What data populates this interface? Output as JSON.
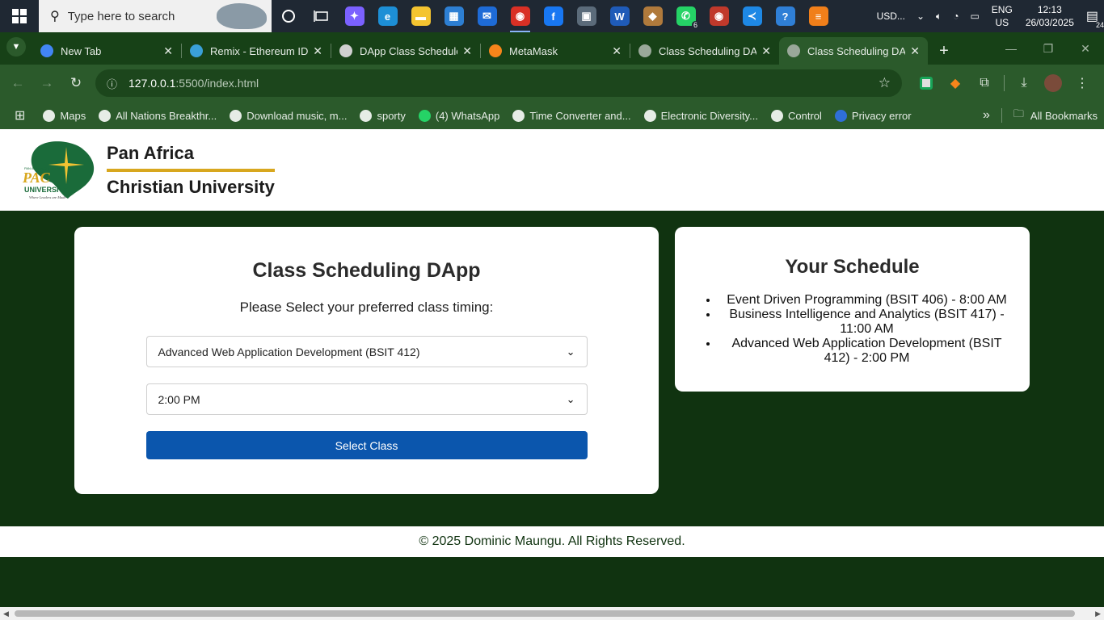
{
  "taskbar": {
    "search_placeholder": "Type here to search",
    "pinned": [
      {
        "name": "copilot-icon",
        "glyph": "✦",
        "color": "#7b61ff"
      },
      {
        "name": "edge-icon",
        "glyph": "e",
        "color": "#1d8fd6"
      },
      {
        "name": "file-explorer-icon",
        "glyph": "▬",
        "color": "#f4c430"
      },
      {
        "name": "microsoft-store-icon",
        "glyph": "▦",
        "color": "#2d7fd3"
      },
      {
        "name": "mail-icon",
        "glyph": "✉",
        "color": "#1e6bd6"
      },
      {
        "name": "chrome-icon",
        "glyph": "◉",
        "color": "#d93025"
      },
      {
        "name": "facebook-icon",
        "glyph": "f",
        "color": "#1877f2"
      },
      {
        "name": "photos-icon",
        "glyph": "▣",
        "color": "#5b6b7a"
      },
      {
        "name": "word-icon",
        "glyph": "W",
        "color": "#1f5bb8"
      },
      {
        "name": "package-icon",
        "glyph": "◆",
        "color": "#b07a3c"
      },
      {
        "name": "whatsapp-icon",
        "glyph": "✆",
        "color": "#25d366"
      },
      {
        "name": "chrome-profile-icon",
        "glyph": "◉",
        "color": "#c0392b"
      },
      {
        "name": "vscode-icon",
        "glyph": "≺",
        "color": "#1e88e5"
      },
      {
        "name": "help-icon",
        "glyph": "?",
        "color": "#2f7fd6"
      },
      {
        "name": "stack-icon",
        "glyph": "≡",
        "color": "#f07f1a"
      }
    ],
    "whatsapp_badge": "6",
    "currency": "USD...",
    "lang_top": "ENG",
    "lang_bottom": "US",
    "time": "12:13",
    "date": "26/03/2025",
    "notif_count": "24"
  },
  "tabs": [
    {
      "title": "New Tab",
      "fav": "#4285f4",
      "favicon": "chrome-icon"
    },
    {
      "title": "Remix - Ethereum IDE",
      "fav": "#3aa0d8",
      "favicon": "remix-icon"
    },
    {
      "title": "DApp Class Schedule",
      "fav": "#d0d0d0",
      "favicon": "openai-icon"
    },
    {
      "title": "MetaMask",
      "fav": "#f6851b",
      "favicon": "metamask-icon"
    },
    {
      "title": "Class Scheduling DAp",
      "fav": "#9aa89a",
      "favicon": "globe-icon"
    },
    {
      "title": "Class Scheduling DA",
      "fav": "#9aa89a",
      "favicon": "globe-icon"
    }
  ],
  "toolbar": {
    "url_host": "127.0.0.1",
    "url_path": ":5500/index.html"
  },
  "bookmarks": [
    {
      "label": "Maps",
      "color": "#e6ece6"
    },
    {
      "label": "All Nations Breakthr...",
      "color": "#e6ece6"
    },
    {
      "label": "Download music, m...",
      "color": "#e6ece6"
    },
    {
      "label": "sporty",
      "color": "#e6ece6"
    },
    {
      "label": "(4) WhatsApp",
      "color": "#25d366"
    },
    {
      "label": "Time Converter and...",
      "color": "#e6ece6"
    },
    {
      "label": "Electronic Diversity...",
      "color": "#e6ece6"
    },
    {
      "label": "Control",
      "color": "#e6ece6"
    },
    {
      "label": "Privacy error",
      "color": "#2f6fd8"
    }
  ],
  "all_bookmarks": "All Bookmarks",
  "logo": {
    "line1": "Pan Africa",
    "line2": "Christian University",
    "mark_top": "PAN AFRICA CHRISTIAN",
    "mark_pac": "PAC",
    "mark_univ": "UNIVERSITY",
    "mark_tagline": "Where Leaders are Made"
  },
  "main": {
    "title": "Class Scheduling DApp",
    "prompt": "Please Select your preferred class timing:",
    "class_selected": "Advanced Web Application Development (BSIT 412)",
    "time_selected": "2:00 PM",
    "button": "Select Class"
  },
  "schedule": {
    "title": "Your Schedule",
    "items": [
      "Event Driven Programming (BSIT 406) - 8:00 AM",
      "Business Intelligence and Analytics (BSIT 417) - 11:00 AM",
      "Advanced Web Application Development (BSIT 412) - 2:00 PM"
    ]
  },
  "footer": "© 2025 Dominic Maungu. All Rights Reserved."
}
